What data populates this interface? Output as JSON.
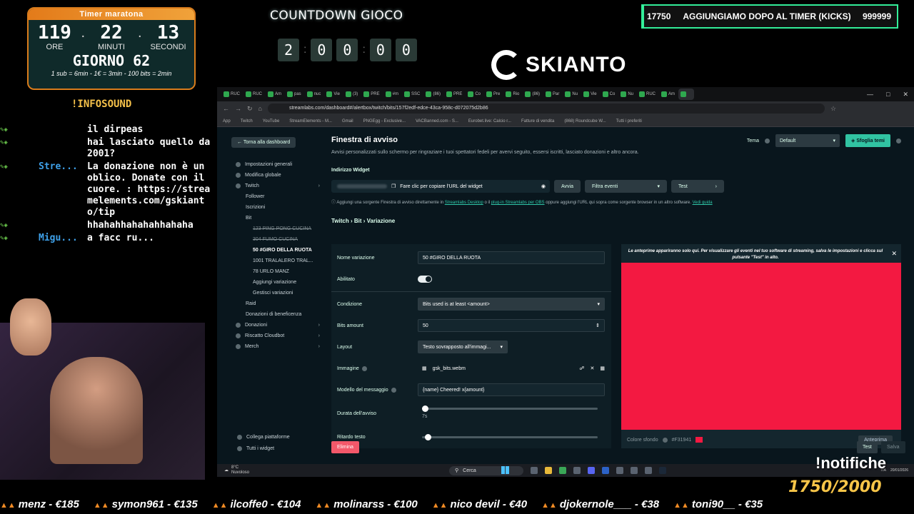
{
  "overlay": {
    "timer": {
      "title": "Timer maratona",
      "hours": "119",
      "minutes": "22",
      "seconds": "13",
      "hours_label": "ORE",
      "minutes_label": "MINUTI",
      "seconds_label": "SECONDI",
      "day": "GIORNO 62",
      "rates": "1 sub = 6min - 1€ = 3min - 100 bits = 2min"
    },
    "infosound": "!INFOSOUND",
    "countdown": {
      "title": "COUNTDOWN GIOCO",
      "digits": [
        "2",
        "0",
        "0",
        "0",
        "0"
      ]
    },
    "logo_text": "SKIANTO",
    "goal_box": {
      "current": "17750",
      "label": "AGGIUNGIAMO DOPO AL TIMER (KICKS)",
      "target": "999999"
    },
    "chat": [
      {
        "user": "",
        "text": "il dirpeas"
      },
      {
        "user": "",
        "text": "hai lasciato quello da 2001?"
      },
      {
        "user": "Stre...",
        "text": "La donazione non è un oblico. Donate con il cuore. : https://streamelements.com/gskianto/tip"
      },
      {
        "user": "",
        "text": "hhahahhahahahhahaha"
      },
      {
        "user": "Migu...",
        "text": "a facc ru..."
      }
    ],
    "notifiche": "!notifiche",
    "goal_counter": "1750/2000",
    "ticker": [
      "menz - €185",
      "symon961 - €135",
      "ilcoffe0 - €104",
      "molinarss - €100",
      "nico devil - €40",
      "djokernole___ - €38",
      "toni90__ - €35"
    ]
  },
  "browser": {
    "tabs": [
      "RUC",
      "RUC",
      "Am",
      "pas",
      "nuc",
      "Vie",
      "(3)",
      "PRE",
      "#m",
      "SSC",
      "(86)",
      "PRE",
      "Co",
      "Pre",
      "Rio",
      "(86)",
      "Par",
      "Nu",
      "Vie",
      "Co",
      "Nu",
      "RUC",
      "Am",
      ""
    ],
    "url": "streamlabs.com/dashboard#/alertbox/twitch/bits/157f2edf-edce-43ca-958c-d072075d2b86",
    "bookmarks": [
      "App",
      "Twitch",
      "YouTube",
      "StreamElements - M...",
      "Gmail",
      "PNGEgg - Exclusive...",
      "VACBanned.com - S...",
      "Eurobet.live: Calcio r...",
      "Fatture di vendita",
      "(868) Roundcube W...",
      "Tutti i preferiti"
    ]
  },
  "sidebar": {
    "back": "Torna alla dashboard",
    "items": [
      {
        "label": "Impostazioni generali",
        "level": 0
      },
      {
        "label": "Modifica globale",
        "level": 0
      },
      {
        "label": "Twitch",
        "level": 0
      },
      {
        "label": "Follower",
        "level": 1
      },
      {
        "label": "Iscrizioni",
        "level": 1
      },
      {
        "label": "Bit",
        "level": 1
      },
      {
        "label": "123 PING PONG CUCINA",
        "level": 2,
        "strike": true
      },
      {
        "label": "304 FUMO CUCINA",
        "level": 2,
        "strike": true
      },
      {
        "label": "50 #GIRO DELLA RUOTA",
        "level": 2,
        "active": true
      },
      {
        "label": "1001 TRALALERO TRAL...",
        "level": 2
      },
      {
        "label": "78 URLO MANZ",
        "level": 2
      },
      {
        "label": "Aggiungi variazione",
        "level": 2
      },
      {
        "label": "Gestisci variazioni",
        "level": 2
      },
      {
        "label": "Raid",
        "level": 1
      },
      {
        "label": "Donazioni di beneficenza",
        "level": 1
      },
      {
        "label": "Donazioni",
        "level": 0
      },
      {
        "label": "Riscatto Cloudbot",
        "level": 0
      },
      {
        "label": "Merch",
        "level": 0
      }
    ],
    "bottom": [
      "Collega piattaforme",
      "Tutti i widget"
    ]
  },
  "main": {
    "title": "Finestra di avviso",
    "subtitle": "Avvisi personalizzati sullo schermo per ringraziare i tuoi spettatori fedeli per avervi seguito, essersi iscritti, lasciato donazioni e altro ancora.",
    "theme_label": "Tema",
    "theme_value": "Default",
    "theme_button": "Sfoglia temi",
    "widget_label": "Indirizzo Widget",
    "widget_copy": "Fare clic per copiare l'URL del widget",
    "btn_launch": "Avvia",
    "btn_filter": "Filtra eventi",
    "btn_test": "Test",
    "helper_pre": "Aggiungi una sorgente Finestra di avviso direttamente in",
    "helper_link1": "Streamlabs Desktop",
    "helper_mid": "o il",
    "helper_link2": "plug-in Streamlabs per OBS",
    "helper_post": "oppure aggiungi l'URL qui sopra come sorgente browser in un altro software.",
    "helper_link3": "Vedi guida",
    "breadcrumb": "Twitch › Bit › Variazione",
    "form": {
      "name_label": "Nome variazione",
      "name_value": "50 #GIRO DELLA RUOTA",
      "enabled_label": "Abilitato",
      "enabled": true,
      "condition_label": "Condizione",
      "condition_value": "Bits used is at least <amount>",
      "bits_label": "Bits amount",
      "bits_value": "50",
      "layout_label": "Layout",
      "layout_value": "Testo sovrapposto all'immagi...",
      "image_label": "Immagine",
      "image_value": "gsk_bits.webm",
      "message_label": "Modello del messaggio",
      "message_value": "{name} Cheered! x{amount}",
      "duration_label": "Durata dell'avviso",
      "duration_value": "7s",
      "delay_label": "Ritardo testo"
    },
    "preview_text": "Le anteprime appariranno solo qui. Per visualizzare gli eventi nel tuo software di streaming, salva le impostazioni e clicca sul pulsante \"Test\" in alto.",
    "bg_color_label": "Colore sfondo",
    "bg_color_value": "#F31941",
    "preview_btn": "Anteprima",
    "delete_btn": "Elimina",
    "test_btn": "Test",
    "save_btn": "Salva"
  },
  "taskbar": {
    "weather_temp": "8°C",
    "weather_desc": "Nuvoloso",
    "search": "Cerca",
    "lang": "ITA",
    "date": "20/01/2026"
  },
  "colors": {
    "accent_green": "#31c3a2",
    "danger": "#f3586a",
    "preview_bg": "#f31941",
    "page_bg": "#09161d"
  }
}
